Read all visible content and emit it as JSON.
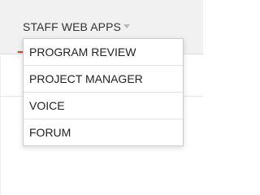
{
  "navbar": {
    "menu_label": "STAFF WEB APPS",
    "accent_color": "#d8431f"
  },
  "dropdown": {
    "items": [
      {
        "label": "PROGRAM REVIEW"
      },
      {
        "label": "PROJECT MANAGER"
      },
      {
        "label": "VOICE"
      },
      {
        "label": "FORUM"
      }
    ]
  },
  "icons": {
    "caret": "caret-down-icon"
  }
}
